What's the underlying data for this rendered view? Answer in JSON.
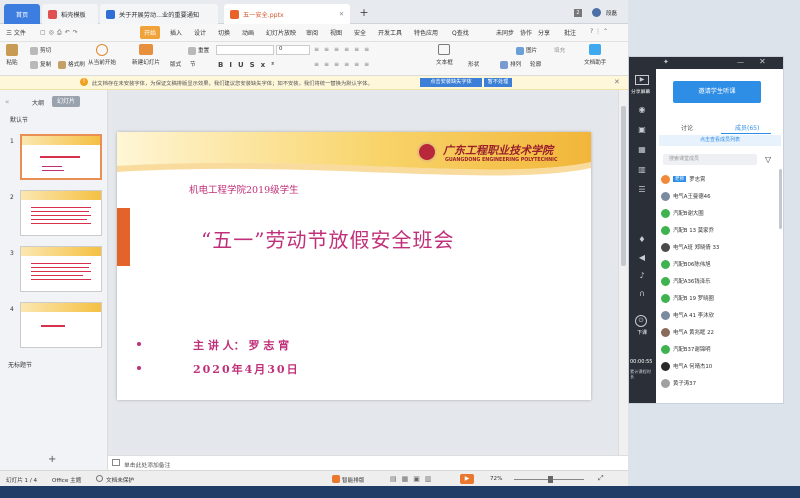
{
  "tabs": [
    {
      "label": "首页",
      "color": "#3d7de0"
    },
    {
      "label": "稻壳模板",
      "color": "#e05050"
    },
    {
      "label": "关于开展劳动...业的重要通知",
      "color": "#2f6fd6"
    },
    {
      "label": "五一安全.pptx",
      "color": "#e8632a"
    }
  ],
  "window": {
    "user": "段磊",
    "badge": "2"
  },
  "menu": {
    "file": "三 文件",
    "items": [
      "开始",
      "插入",
      "设计",
      "切换",
      "动画",
      "幻灯片放映",
      "审阅",
      "视图",
      "安全",
      "开发工具",
      "特色应用",
      "Q查找"
    ],
    "right": [
      "未同步",
      "协作",
      "分享",
      "批注"
    ]
  },
  "ribbon": {
    "paste": "粘贴",
    "cut": "剪切",
    "copy": "复制",
    "format_painter": "格式刷",
    "from_start": "从当前开始",
    "new_slide": "新建幻灯片",
    "layout": "版式",
    "section": "节",
    "reset": "重置",
    "font_size": "0",
    "textbox": "文本框",
    "shape": "形状",
    "arrange": "排列",
    "outline": "轮廓",
    "picture": "图片",
    "fill": "填充",
    "doc_assist": "文档助手"
  },
  "notify": {
    "text": "此文档存在未安装字体，为保证文稿排版显示效果，我们建议您安装缺失字体；如不安装，我们将统一替换为默认字体。",
    "btn_install": "点击安装缺失字体",
    "btn_no": "暂不处理"
  },
  "left_panel": {
    "tab_outline": "大纲",
    "tab_slides": "幻灯片",
    "section_default": "默认节",
    "section_untitled": "无标题节",
    "slide_nums": [
      "1",
      "2",
      "3",
      "4"
    ]
  },
  "slide": {
    "college_cn": "广东工程职业技术学院",
    "college_en": "GUANGDONG ENGINEERING POLYTECHNIC",
    "subtitle": "机电工程学院2019级学生",
    "title": "“五一”劳动节放假安全班会",
    "speaker": "主 讲 人： 罗 志 宵",
    "date": "2020年4月30日"
  },
  "notes": {
    "placeholder": "单击此处添加备注"
  },
  "status": {
    "slide_count": "幻灯片 1 / 4",
    "theme": "Office 主题",
    "protect": "文档未保护",
    "smart": "智能排版",
    "zoom": "72%"
  },
  "meet": {
    "invite_btn": "邀请学生听课",
    "tab_discuss": "讨论",
    "tab_members": "成员(65)",
    "click_view": "点击查看成员列表",
    "search_placeholder": "搜索课堂成员",
    "side": [
      "分享屏幕",
      "下课"
    ],
    "time": "00:00:55",
    "time_label": "累计课程时长",
    "members": [
      {
        "name": "罗志霄",
        "badge": "老师",
        "color": "#f08a3a"
      },
      {
        "name": "电气A王曼德46",
        "color": "#7a8aa0"
      },
      {
        "name": "汽配B谢大圈",
        "color": "#3fb34f"
      },
      {
        "name": "汽配B 13 莫家乔",
        "color": "#3fb34f"
      },
      {
        "name": "电气A班 郑晓倩 33",
        "color": "#4a4a4a"
      },
      {
        "name": "汽配B06陈伟旭",
        "color": "#3fb34f"
      },
      {
        "name": "汽配A36钱泽乐",
        "color": "#3fb34f"
      },
      {
        "name": "汽配B 19 罗晓圈",
        "color": "#3fb34f"
      },
      {
        "name": "电气A 41 李沐欣",
        "color": "#7a8aa0"
      },
      {
        "name": "电气A 黄兆眶 22",
        "color": "#8a6a5a"
      },
      {
        "name": "汽配B37谢锦明",
        "color": "#3fb34f"
      },
      {
        "name": "电气A 何晴杰10",
        "color": "#2a2a2a"
      },
      {
        "name": "黄子涛37",
        "color": "#a0a0a0"
      }
    ]
  },
  "colors": {
    "accent_orange": "#e9782e",
    "slide_red": "#c0307a",
    "meet_blue": "#2e8ee6"
  }
}
